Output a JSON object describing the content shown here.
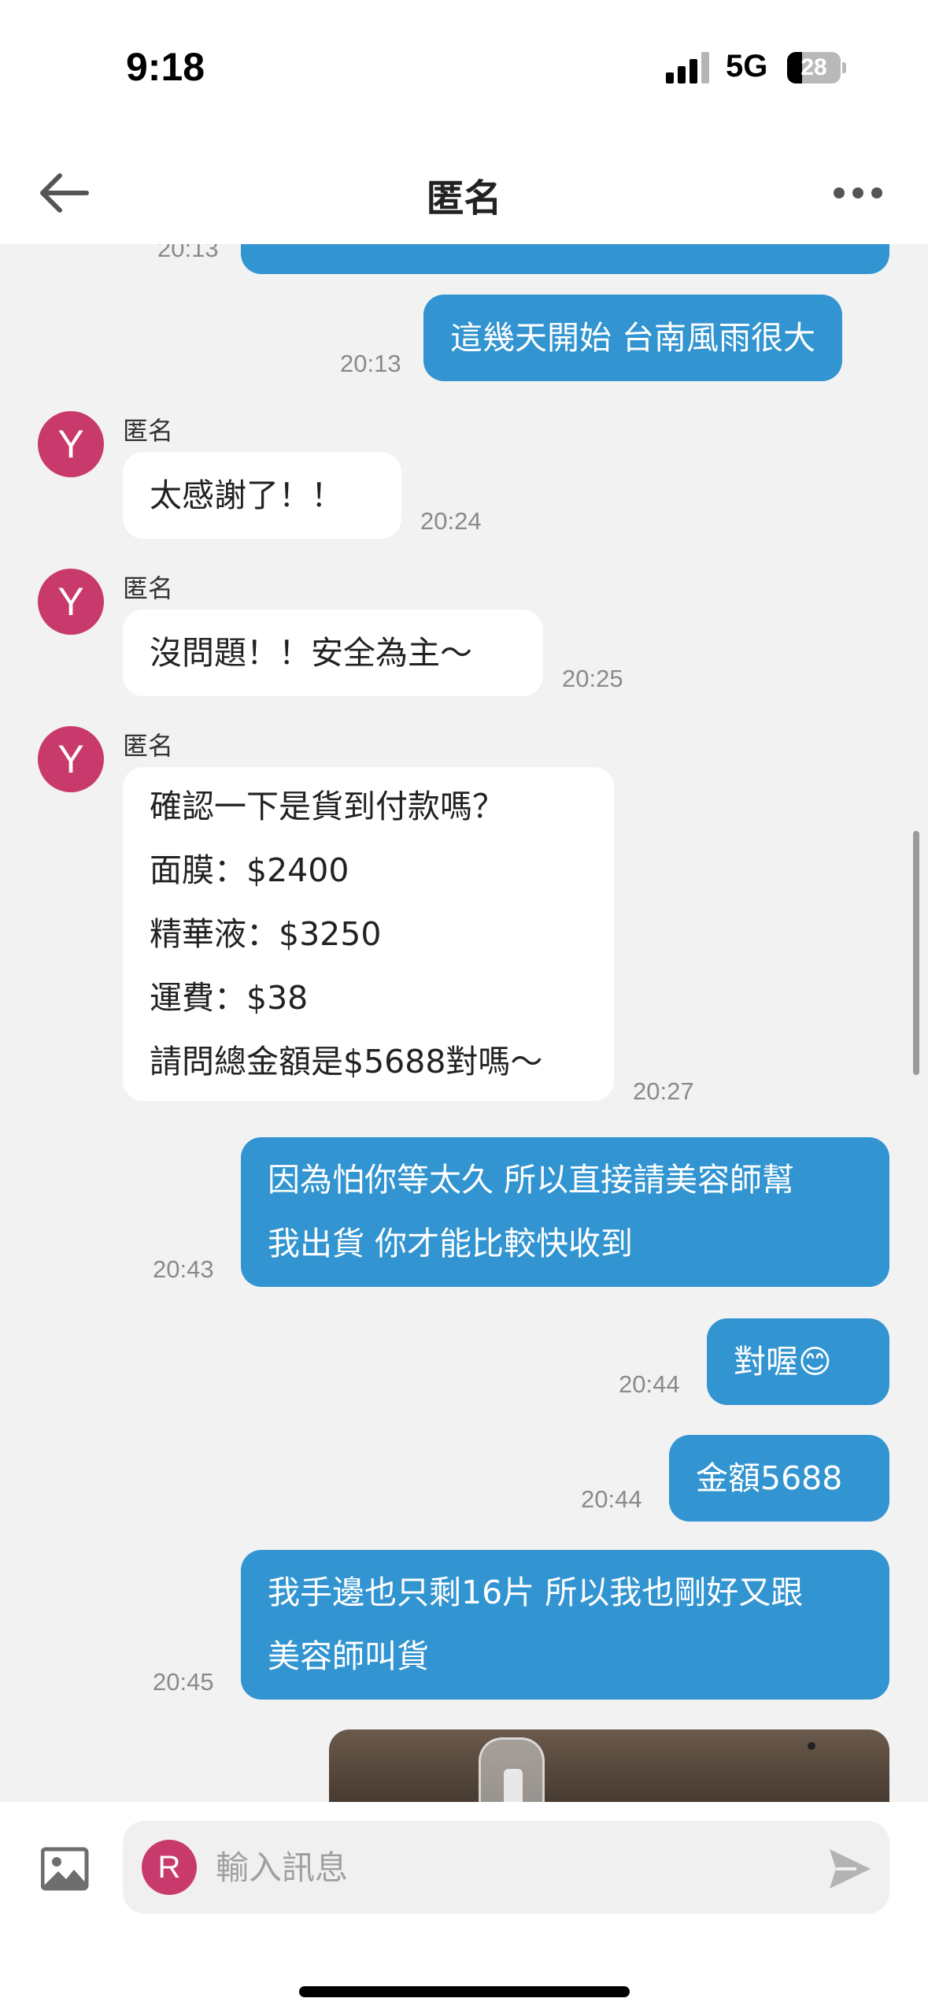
{
  "status_bar": {
    "time": "9:18",
    "network": "5G",
    "battery": "28",
    "battery_level": 0.28
  },
  "nav": {
    "title": "匿名"
  },
  "messages": [
    {
      "dir": "out",
      "lines": [
        ""
      ],
      "time": "20:13"
    },
    {
      "dir": "out",
      "lines": [
        "這幾天開始 台南風雨很大"
      ],
      "time": "20:13"
    },
    {
      "dir": "in",
      "avatar": "Y",
      "sender": "匿名",
      "lines": [
        "太感謝了！！"
      ],
      "time": "20:24"
    },
    {
      "dir": "in",
      "avatar": "Y",
      "sender": "匿名",
      "lines": [
        "沒問題！！安全為主～"
      ],
      "time": "20:25"
    },
    {
      "dir": "in",
      "avatar": "Y",
      "sender": "匿名",
      "lines": [
        "確認一下是貨到付款嗎？",
        "面膜：$2400",
        "精華液：$3250",
        "運費：$38",
        "請問總金額是$5688對嗎～"
      ],
      "time": "20:27"
    },
    {
      "dir": "out",
      "lines": [
        "因為怕你等太久 所以直接請美容師幫",
        "我出貨 你才能比較快收到"
      ],
      "time": "20:43"
    },
    {
      "dir": "out",
      "lines": [
        "對喔😊"
      ],
      "time": "20:44"
    },
    {
      "dir": "out",
      "lines": [
        "金額5688"
      ],
      "time": "20:44"
    },
    {
      "dir": "out",
      "lines": [
        "我手邊也只剩16片 所以我也剛好又跟",
        "美容師叫貨"
      ],
      "time": "20:45"
    }
  ],
  "composer": {
    "avatar": "R",
    "placeholder": "輸入訊息",
    "value": ""
  },
  "colors": {
    "outgoing_bubble": "#3294d0",
    "incoming_bubble": "#ffffff",
    "avatar": "#c93a6c",
    "background": "#f2f2f2"
  },
  "icons": {
    "back": "arrow-left-icon",
    "more": "more-horizontal-icon",
    "image": "image-icon",
    "send": "send-icon"
  }
}
